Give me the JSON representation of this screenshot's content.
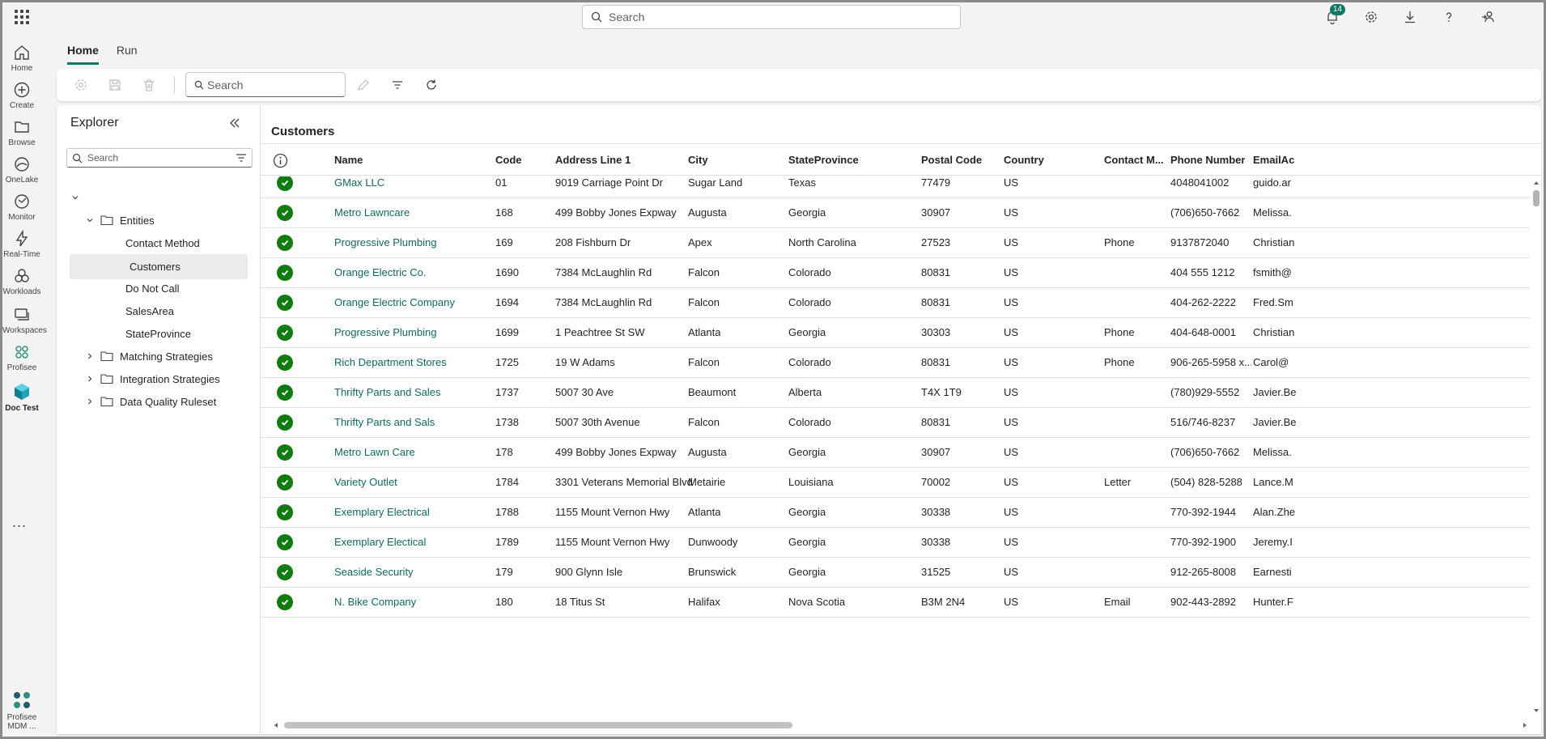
{
  "global_search": {
    "placeholder": "Search"
  },
  "notifications": {
    "count": "14"
  },
  "rail": {
    "items": [
      {
        "label": "Home",
        "icon": "home-icon"
      },
      {
        "label": "Create",
        "icon": "plus-circle-icon"
      },
      {
        "label": "Browse",
        "icon": "folder-icon"
      },
      {
        "label": "OneLake",
        "icon": "onelake-icon"
      },
      {
        "label": "Monitor",
        "icon": "monitor-icon"
      },
      {
        "label": "Real-Time",
        "icon": "lightning-icon"
      },
      {
        "label": "Workloads",
        "icon": "workloads-icon"
      },
      {
        "label": "Workspaces",
        "icon": "workspaces-icon"
      },
      {
        "label": "Profisee",
        "icon": "profisee-icon"
      },
      {
        "label": "Doc Test",
        "icon": "doc-test-icon"
      }
    ],
    "more": "...",
    "bottom": {
      "label_line1": "Profisee",
      "label_line2": "MDM ..."
    }
  },
  "tabs": [
    {
      "label": "Home"
    },
    {
      "label": "Run"
    }
  ],
  "toolbar": {
    "search_placeholder": "Search"
  },
  "explorer": {
    "title": "Explorer",
    "search_placeholder": "Search",
    "items": [
      {
        "label": "Entities"
      },
      {
        "label": "Contact Method"
      },
      {
        "label": "Customers"
      },
      {
        "label": "Do Not Call"
      },
      {
        "label": "SalesArea"
      },
      {
        "label": "StateProvince"
      },
      {
        "label": "Matching Strategies"
      },
      {
        "label": "Integration Strategies"
      },
      {
        "label": "Data Quality Ruleset"
      }
    ]
  },
  "grid": {
    "title": "Customers",
    "columns": [
      "Name",
      "Code",
      "Address Line 1",
      "City",
      "StateProvince",
      "Postal Code",
      "Country",
      "Contact M...",
      "Phone Number",
      "EmailAc"
    ],
    "rows": [
      [
        "GMax LLC",
        "01",
        "9019 Carriage Point Dr",
        "Sugar Land",
        "Texas",
        "77479",
        "US",
        "",
        "4048041002",
        "guido.ar"
      ],
      [
        "Metro Lawncare",
        "168",
        "499 Bobby Jones Expway",
        "Augusta",
        "Georgia",
        "30907",
        "US",
        "",
        "(706)650-7662",
        "Melissa."
      ],
      [
        "Progressive Plumbing",
        "169",
        "208 Fishburn Dr",
        "Apex",
        "North Carolina",
        "27523",
        "US",
        "Phone",
        "9137872040",
        "Christian"
      ],
      [
        "Orange Electric Co.",
        "1690",
        "7384 McLaughlin Rd",
        "Falcon",
        "Colorado",
        "80831",
        "US",
        "",
        "404 555 1212",
        "fsmith@"
      ],
      [
        "Orange Electric Company",
        "1694",
        "7384 McLaughlin Rd",
        "Falcon",
        "Colorado",
        "80831",
        "US",
        "",
        "404-262-2222",
        "Fred.Sm"
      ],
      [
        "Progressive Plumbing",
        "1699",
        "1 Peachtree St SW",
        "Atlanta",
        "Georgia",
        "30303",
        "US",
        "Phone",
        "404-648-0001",
        "Christian"
      ],
      [
        "Rich Department Stores",
        "1725",
        "19 W Adams",
        "Falcon",
        "Colorado",
        "80831",
        "US",
        "Phone",
        "906-265-5958 x...",
        "Carol@"
      ],
      [
        "Thrifty Parts and Sales",
        "1737",
        "5007 30 Ave",
        "Beaumont",
        "Alberta",
        "T4X 1T9",
        "US",
        "",
        "(780)929-5552",
        "Javier.Be"
      ],
      [
        "Thrifty Parts and Sals",
        "1738",
        "5007 30th Avenue",
        "Falcon",
        "Colorado",
        "80831",
        "US",
        "",
        "516/746-8237",
        "Javier.Be"
      ],
      [
        "Metro Lawn Care",
        "178",
        "499 Bobby Jones Expway",
        "Augusta",
        "Georgia",
        "30907",
        "US",
        "",
        "(706)650-7662",
        "Melissa."
      ],
      [
        "Variety Outlet",
        "1784",
        "3301 Veterans Memorial Blvd",
        "Metairie",
        "Louisiana",
        "70002",
        "US",
        "Letter",
        "(504) 828-5288",
        "Lance.M"
      ],
      [
        "Exemplary Electrical",
        "1788",
        "1155 Mount Vernon Hwy",
        "Atlanta",
        "Georgia",
        "30338",
        "US",
        "",
        "770-392-1944",
        "Alan.Zhe"
      ],
      [
        "Exemplary Electical",
        "1789",
        "1155 Mount Vernon Hwy",
        "Dunwoody",
        "Georgia",
        "30338",
        "US",
        "",
        "770-392-1900",
        "Jeremy.I"
      ],
      [
        "Seaside Security",
        "179",
        "900 Glynn Isle",
        "Brunswick",
        "Georgia",
        "31525",
        "US",
        "",
        "912-265-8008",
        "Earnesti"
      ],
      [
        "N. Bike Company",
        "180",
        "18 Titus St",
        "Halifax",
        "Nova Scotia",
        "B3M 2N4",
        "US",
        "Email",
        "902-443-2892",
        "Hunter.F"
      ]
    ]
  },
  "colors": {
    "accent": "#117865",
    "link": "#0f6b5a",
    "status_ok": "#107c10"
  }
}
